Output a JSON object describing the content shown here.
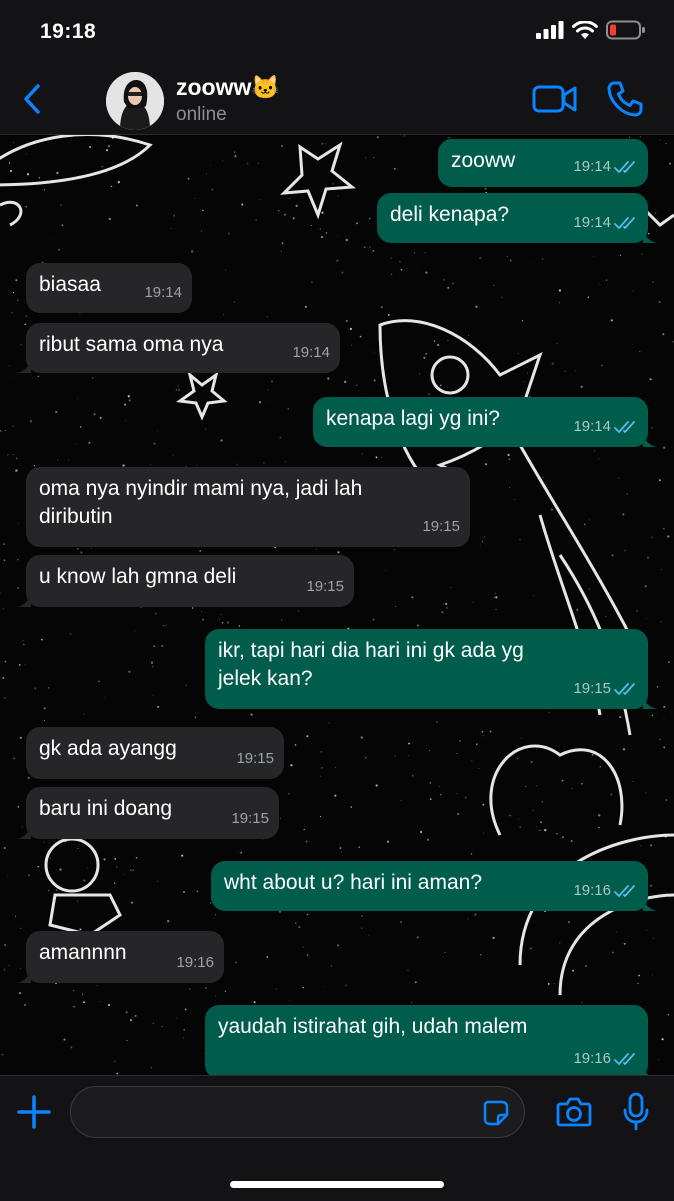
{
  "status_bar": {
    "time": "19:18"
  },
  "header": {
    "contact_name": "zooww🐱",
    "contact_status": "online"
  },
  "messages": [
    {
      "dir": "out",
      "text": "zooww",
      "time": "19:14"
    },
    {
      "dir": "out",
      "text": "deli kenapa?",
      "time": "19:14"
    },
    {
      "dir": "in",
      "text": "biasaa",
      "time": "19:14"
    },
    {
      "dir": "in",
      "text": "ribut sama oma nya",
      "time": "19:14"
    },
    {
      "dir": "out",
      "text": "kenapa lagi yg ini?",
      "time": "19:14"
    },
    {
      "dir": "in",
      "text": "oma nya nyindir mami nya, jadi lah\ndiributin",
      "time": "19:15"
    },
    {
      "dir": "in",
      "text": "u know lah gmna deli",
      "time": "19:15"
    },
    {
      "dir": "out",
      "text": "ikr, tapi hari dia hari ini gk ada yg\njelek kan?",
      "time": "19:15"
    },
    {
      "dir": "in",
      "text": "gk ada ayangg",
      "time": "19:15"
    },
    {
      "dir": "in",
      "text": "baru ini doang",
      "time": "19:15"
    },
    {
      "dir": "out",
      "text": "wht about u? hari ini aman?",
      "time": "19:16"
    },
    {
      "dir": "in",
      "text": "amannnn",
      "time": "19:16"
    },
    {
      "dir": "out",
      "text": "yaudah istirahat gih, udah malem",
      "time": "19:16"
    }
  ],
  "colors": {
    "accent": "#0a84ff",
    "outgoing_bubble": "#005c4b",
    "incoming_bubble": "#262628",
    "read_ticks": "#53bdeb",
    "battery_low": "#ff3b30"
  },
  "icons": [
    "back-icon",
    "video-call-icon",
    "phone-call-icon",
    "plus-icon",
    "sticker-icon",
    "camera-icon",
    "microphone-icon"
  ]
}
